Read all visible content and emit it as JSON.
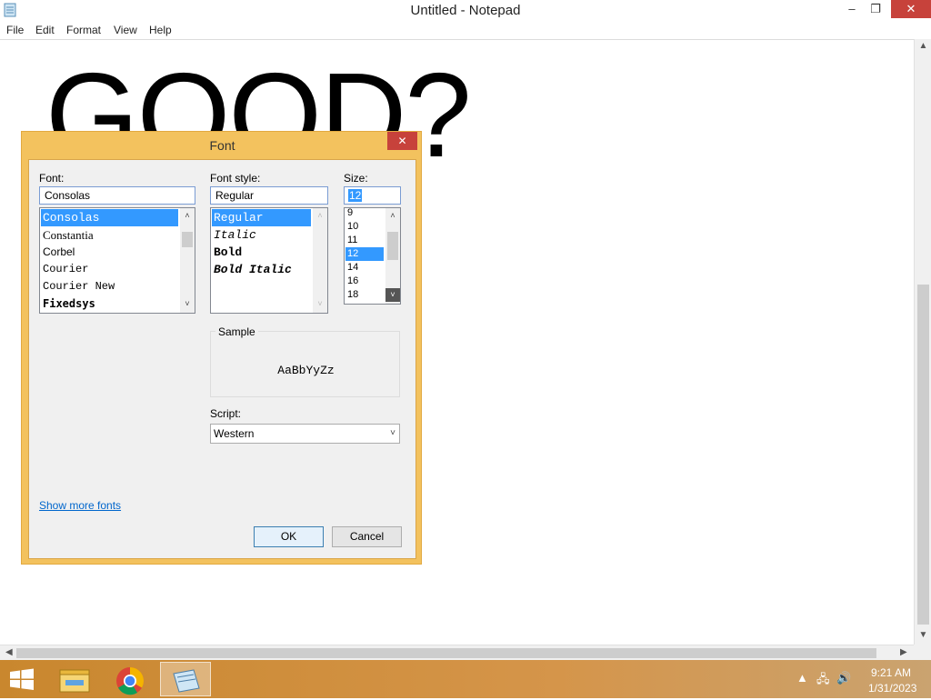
{
  "window": {
    "title": "Untitled - Notepad",
    "minimize_glyph": "–",
    "maximize_glyph": "❐",
    "close_glyph": "✕"
  },
  "menu": [
    "File",
    "Edit",
    "Format",
    "View",
    "Help"
  ],
  "editor": {
    "text": "GOOD?"
  },
  "dialog": {
    "title": "Font",
    "close_glyph": "✕",
    "font_label": "Font:",
    "font_value": "Consolas",
    "font_list": [
      "Consolas",
      "Constantia",
      "Corbel",
      "Courier",
      "Courier New",
      "Fixedsys"
    ],
    "style_label": "Font style:",
    "style_value": "Regular",
    "style_list": [
      "Regular",
      "Italic",
      "Bold",
      "Bold Italic"
    ],
    "size_label": "Size:",
    "size_value": "12",
    "size_list": [
      "9",
      "10",
      "11",
      "12",
      "14",
      "16",
      "18"
    ],
    "sample_label": "Sample",
    "sample_text": "AaBbYyZz",
    "script_label": "Script:",
    "script_value": "Western",
    "show_more_label": "Show more fonts",
    "ok_label": "OK",
    "cancel_label": "Cancel"
  },
  "taskbar": {
    "apps": [
      "windows-start-icon",
      "file-explorer-icon",
      "chrome-icon",
      "notepad-icon"
    ],
    "time": "9:21 AM",
    "date": "1/31/2023",
    "tray_icons": [
      "show-hidden-icons",
      "network-icon",
      "volume-icon"
    ]
  },
  "colors": {
    "dialog_frame": "#f3c25e",
    "selection": "#3399ff",
    "close_button": "#c7423b",
    "taskbar": "#c9872e",
    "link": "#0066cc"
  }
}
